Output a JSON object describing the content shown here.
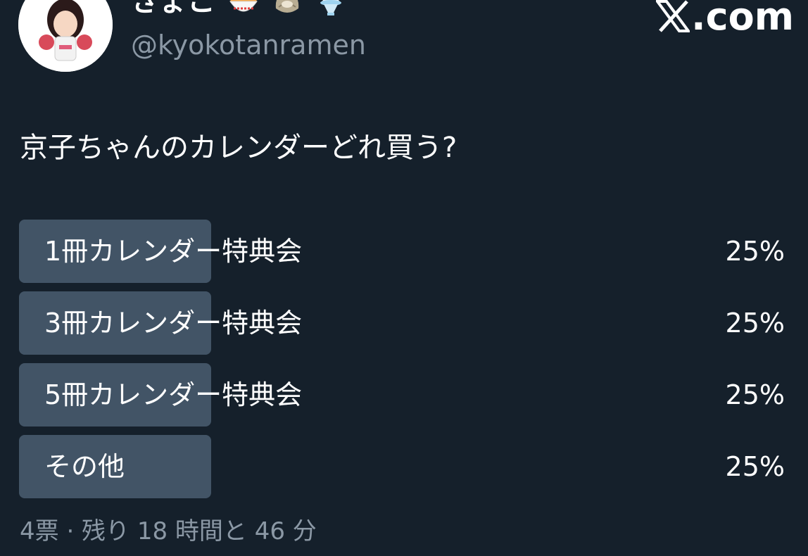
{
  "header": {
    "display_name": "きょこ",
    "display_name_emojis": [
      "ramen-bowl-icon",
      "oyster-icon",
      "shaved-ice-icon"
    ],
    "handle": "@kyokotanramen",
    "brand": ".com"
  },
  "tweet": {
    "question": "京子ちゃんのカレンダーどれ買う?"
  },
  "poll": {
    "options": [
      {
        "label": "1冊カレンダー特典会",
        "percent_text": "25%",
        "percent": 25
      },
      {
        "label": "3冊カレンダー特典会",
        "percent_text": "25%",
        "percent": 25
      },
      {
        "label": "5冊カレンダー特典会",
        "percent_text": "25%",
        "percent": 25
      },
      {
        "label": "その他",
        "percent_text": "25%",
        "percent": 25
      }
    ],
    "summary": "4票 · 残り 18 時間と 46 分"
  },
  "colors": {
    "background": "#15202b",
    "bar_fill": "#425466",
    "secondary_text": "#8b98a5",
    "primary_text": "#ffffff"
  }
}
